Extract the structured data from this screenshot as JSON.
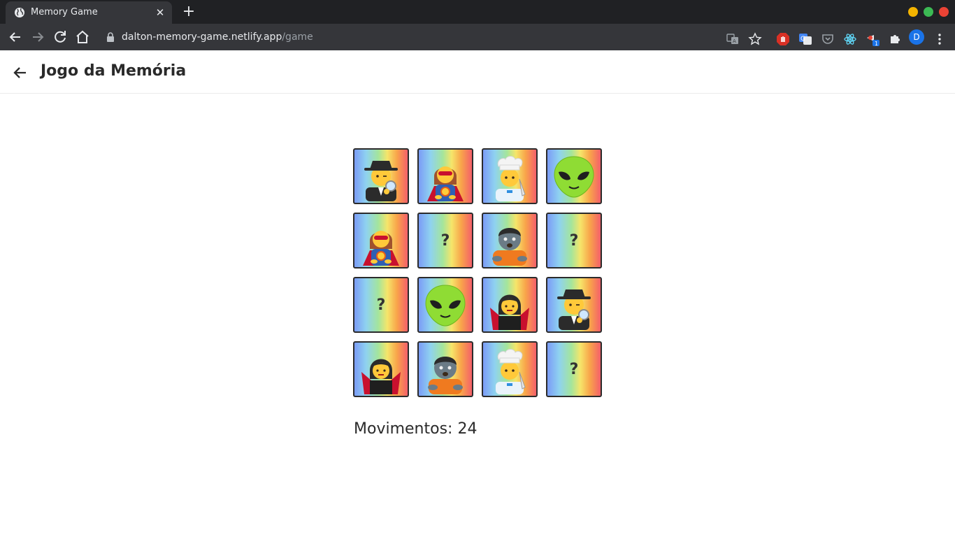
{
  "browser": {
    "tab_title": "Memory Game",
    "tab_close": "✕",
    "new_tab": "+",
    "url_host": "dalton-memory-game.netlify.app",
    "url_path": "/game",
    "profile_initial": "D",
    "extension_badge": "1",
    "window_colors": {
      "minimize": "#f4b400",
      "maximize": "#3cba54",
      "close": "#ea4335"
    }
  },
  "app": {
    "title": "Jogo da Memória",
    "moves_label": "Movimentos:",
    "moves_count": "24"
  },
  "board": {
    "rows": 4,
    "columns": 4,
    "cards": [
      {
        "state": "revealed",
        "icon": "detective-woman"
      },
      {
        "state": "revealed",
        "icon": "superhero-woman"
      },
      {
        "state": "revealed",
        "icon": "cook"
      },
      {
        "state": "revealed",
        "icon": "alien"
      },
      {
        "state": "revealed",
        "icon": "superhero-woman"
      },
      {
        "state": "hidden",
        "label": "?"
      },
      {
        "state": "revealed",
        "icon": "zombie"
      },
      {
        "state": "hidden",
        "label": "?"
      },
      {
        "state": "hidden",
        "label": "?"
      },
      {
        "state": "revealed",
        "icon": "alien"
      },
      {
        "state": "revealed",
        "icon": "vampire"
      },
      {
        "state": "revealed",
        "icon": "detective-woman"
      },
      {
        "state": "revealed",
        "icon": "vampire"
      },
      {
        "state": "revealed",
        "icon": "zombie"
      },
      {
        "state": "revealed",
        "icon": "cook"
      },
      {
        "state": "hidden",
        "label": "?"
      }
    ]
  }
}
